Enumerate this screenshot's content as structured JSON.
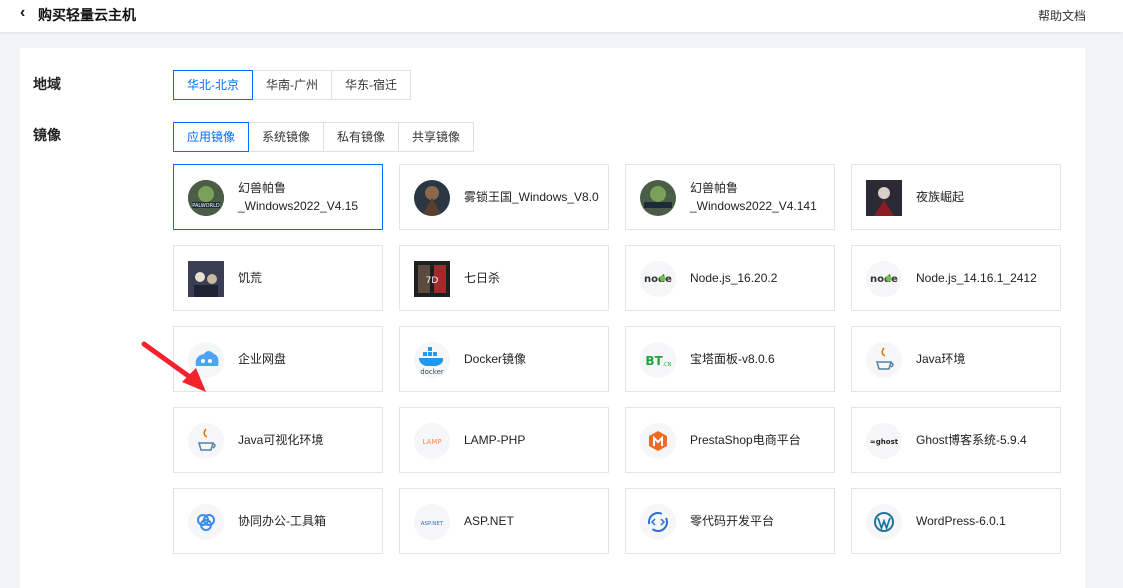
{
  "header": {
    "back_icon": "chevron-left-icon",
    "title": "购买轻量云主机",
    "help": "帮助文档"
  },
  "region": {
    "label": "地域",
    "options": [
      "华北-北京",
      "华南-广州",
      "华东-宿迁"
    ],
    "selected": "华北-北京"
  },
  "image": {
    "label": "镜像",
    "tabs": [
      "应用镜像",
      "系统镜像",
      "私有镜像",
      "共享镜像"
    ],
    "selected_tab": "应用镜像",
    "items": [
      {
        "name": "幻兽帕鲁 _Windows2022_V4.15",
        "icon": "palworld-game-icon"
      },
      {
        "name": "雾锁王国_Windows_V8.0",
        "icon": "enshrouded-game-icon"
      },
      {
        "name": "幻兽帕鲁 _Windows2022_V4.141",
        "icon": "palworld-game-icon"
      },
      {
        "name": "夜族崛起",
        "icon": "v-rising-game-icon"
      },
      {
        "name": "饥荒",
        "icon": "dont-starve-game-icon"
      },
      {
        "name": "七日杀",
        "icon": "7-days-to-die-game-icon"
      },
      {
        "name": "Node.js_16.20.2",
        "icon": "nodejs-icon"
      },
      {
        "name": "Node.js_14.16.1_2412",
        "icon": "nodejs-icon"
      },
      {
        "name": "企业网盘",
        "icon": "cloud-disk-icon"
      },
      {
        "name": "Docker镜像",
        "icon": "docker-icon"
      },
      {
        "name": "宝塔面板-v8.0.6",
        "icon": "bt-panel-icon"
      },
      {
        "name": "Java环境",
        "icon": "java-icon"
      },
      {
        "name": "Java可视化环境",
        "icon": "java-icon"
      },
      {
        "name": "LAMP-PHP",
        "icon": "lamp-icon"
      },
      {
        "name": "PrestaShop电商平台",
        "icon": "prestashop-icon"
      },
      {
        "name": "Ghost博客系统-5.9.4",
        "icon": "ghost-icon"
      },
      {
        "name": "协同办公-工具箱",
        "icon": "collaboration-icon"
      },
      {
        "name": "ASP.NET",
        "icon": "aspnet-icon"
      },
      {
        "name": "零代码开发平台",
        "icon": "no-code-icon"
      },
      {
        "name": "WordPress-6.0.1",
        "icon": "wordpress-icon"
      }
    ],
    "selected_item": "幻兽帕鲁 _Windows2022_V4.15"
  },
  "annotation": {
    "icon": "red-arrow-icon",
    "color": "#f5222d"
  },
  "colors": {
    "accent": "#006eff",
    "border": "#e3e5ea"
  },
  "icon_text": {
    "node": "node",
    "bt": "BT",
    "bt_cn": ".CN",
    "lamp": "LAMP",
    "ghost": "≈ghost",
    "aspnet": "ASP.NET",
    "docker": "docker",
    "game1": "PALWORLD",
    "game6": "7D"
  }
}
